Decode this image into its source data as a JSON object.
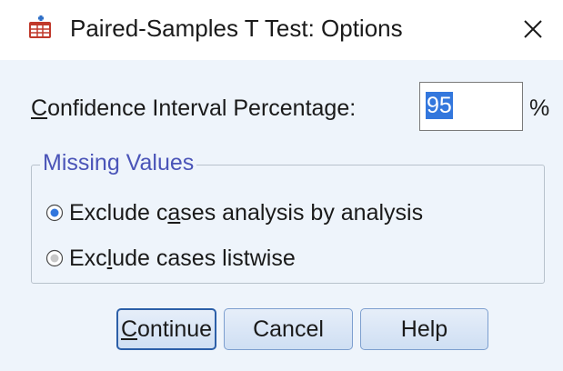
{
  "window": {
    "title": "Paired-Samples T Test: Options",
    "app_icon": "spss-table-icon",
    "close_icon": "close-icon"
  },
  "confidence": {
    "label_prefix": "C",
    "label_rest": "onfidence Interval Percentage:",
    "value": "95",
    "unit": "%"
  },
  "missing_values": {
    "legend": "Missing Values",
    "options": [
      {
        "pre": "Exclude c",
        "accel": "a",
        "post": "ses analysis by analysis",
        "selected": true
      },
      {
        "pre": "Exc",
        "accel": "l",
        "post": "ude cases listwise",
        "selected": false
      }
    ]
  },
  "buttons": {
    "continue_accel": "C",
    "continue_rest": "ontinue",
    "cancel": "Cancel",
    "help": "Help"
  },
  "colors": {
    "client_bg": "#eef4fb",
    "legend_text": "#4a54b8",
    "selection_bg": "#3377dd",
    "button_border": "#7d9fcf",
    "default_border": "#2c5fa8"
  }
}
